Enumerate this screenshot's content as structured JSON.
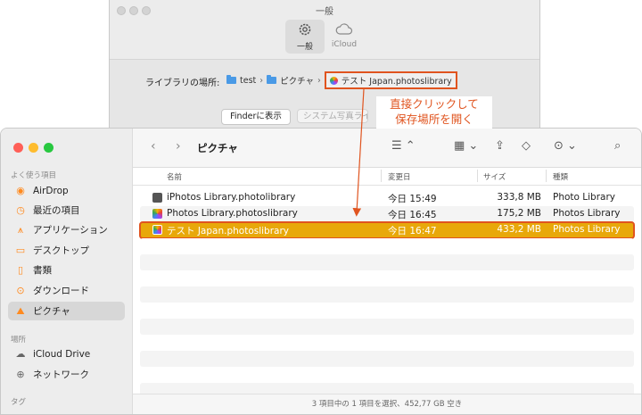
{
  "prefs": {
    "title": "一般",
    "tabs": [
      {
        "label": "一般",
        "icon": "gear-icon"
      },
      {
        "label": "iCloud",
        "icon": "cloud-icon"
      }
    ],
    "library_label": "ライブラリの場所:",
    "path": [
      "test",
      "ピクチャ",
      "テスト Japan.photoslibrary"
    ],
    "finder_button": "Finderに表示",
    "system_button": "システム写真ライ"
  },
  "annotation": {
    "line1": "直接クリックして",
    "line2": "保存場所を開く"
  },
  "finder": {
    "title": "ピクチャ",
    "sidebar": {
      "section_favorites": "よく使う項目",
      "favorites": [
        {
          "label": "AirDrop",
          "icon": "airdrop-icon"
        },
        {
          "label": "最近の項目",
          "icon": "clock-icon"
        },
        {
          "label": "アプリケーション",
          "icon": "applications-icon"
        },
        {
          "label": "デスクトップ",
          "icon": "desktop-icon"
        },
        {
          "label": "書類",
          "icon": "document-icon"
        },
        {
          "label": "ダウンロード",
          "icon": "download-icon"
        },
        {
          "label": "ピクチャ",
          "icon": "pictures-icon"
        }
      ],
      "section_locations": "場所",
      "locations": [
        {
          "label": "iCloud Drive",
          "icon": "cloud-icon"
        },
        {
          "label": "ネットワーク",
          "icon": "network-icon"
        }
      ],
      "section_tags": "タグ"
    },
    "columns": {
      "name": "名前",
      "date": "変更日",
      "size": "サイズ",
      "kind": "種類"
    },
    "rows": [
      {
        "name": "iPhotos Library.photolibrary",
        "date": "今日 15:49",
        "size": "333,8 MB",
        "kind": "Photo Library"
      },
      {
        "name": "Photos Library.photoslibrary",
        "date": "今日 16:45",
        "size": "175,2 MB",
        "kind": "Photos Library"
      },
      {
        "name": "テスト Japan.photoslibrary",
        "date": "今日 16:47",
        "size": "433,2 MB",
        "kind": "Photos Library"
      }
    ],
    "status": "3 項目中の 1 項目を選択、452,77 GB 空き"
  },
  "colors": {
    "accent": "#e0541f",
    "selection": "#e8a80a",
    "folder": "#4a9ae6"
  }
}
